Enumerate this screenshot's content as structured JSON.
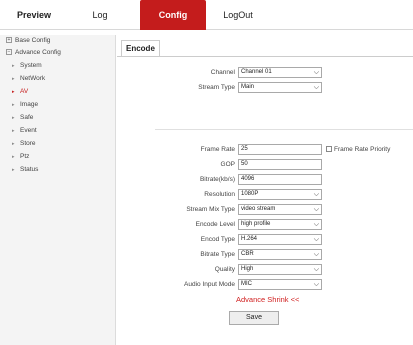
{
  "nav": {
    "tabs": [
      "Preview",
      "Log",
      "Config",
      "LogOut"
    ]
  },
  "sidebar": {
    "base_config": "Base Config",
    "advance_config": "Advance Config",
    "items": [
      "System",
      "NetWork",
      "AV",
      "Image",
      "Safe",
      "Event",
      "Store",
      "Ptz",
      "Status"
    ],
    "active_item": "AV"
  },
  "encode": {
    "tab_label": "Encode",
    "channel": {
      "label": "Channel",
      "value": "Channel 01"
    },
    "stream_type": {
      "label": "Stream Type",
      "value": "Main"
    },
    "frame_rate": {
      "label": "Frame Rate",
      "value": "25"
    },
    "frame_rate_priority": {
      "label": "Frame Rate Priority",
      "checked": false
    },
    "gop": {
      "label": "GOP",
      "value": "50"
    },
    "bitrate": {
      "label": "Bitrate(kb/s)",
      "value": "4096"
    },
    "resolution": {
      "label": "Resolution",
      "value": "1080P"
    },
    "stream_mix_type": {
      "label": "Stream Mix Type",
      "value": "video stream"
    },
    "encode_level": {
      "label": "Encode Level",
      "value": "high profile"
    },
    "encod_type": {
      "label": "Encod Type",
      "value": "H.264"
    },
    "bitrate_type": {
      "label": "Bitrate Type",
      "value": "CBR"
    },
    "quality": {
      "label": "Quality",
      "value": "High"
    },
    "audio_input_mode": {
      "label": "Audio Input Mode",
      "value": "MIC"
    },
    "advance_shrink": "Advance Shrink <<",
    "save": "Save"
  },
  "colors": {
    "accent": "#c41c1c",
    "shrink_text": "#d12020"
  }
}
